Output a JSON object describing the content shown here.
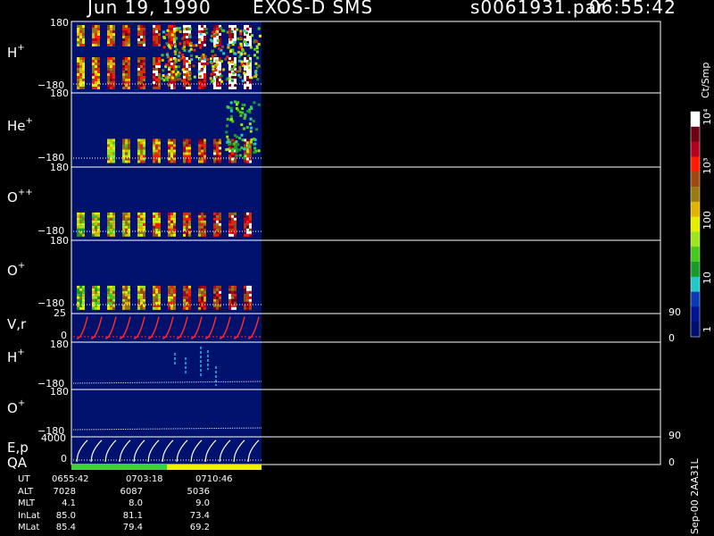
{
  "header": {
    "date": "Jun 19, 1990",
    "instrument": "EXOS-D SMS",
    "file": "s0061931.par",
    "time": "06:55:42"
  },
  "panels": [
    {
      "label": "H",
      "sup": "+",
      "tick_top": "180",
      "tick_bottom": "−180",
      "right_top": "",
      "right_bottom": ""
    },
    {
      "label": "He",
      "sup": "+",
      "tick_top": "180",
      "tick_bottom": "−180",
      "right_top": "",
      "right_bottom": ""
    },
    {
      "label": "O",
      "sup": "++",
      "tick_top": "180",
      "tick_bottom": "−180",
      "right_top": "",
      "right_bottom": ""
    },
    {
      "label": "O",
      "sup": "+",
      "tick_top": "180",
      "tick_bottom": "−180",
      "right_top": "",
      "right_bottom": ""
    },
    {
      "label": "V,r",
      "sup": "",
      "tick_top": "25",
      "tick_bottom": "0",
      "right_top": "90",
      "right_bottom": "0"
    },
    {
      "label": "H",
      "sup": "+",
      "tick_top": "180",
      "tick_bottom": "−180",
      "right_top": "",
      "right_bottom": ""
    },
    {
      "label": "O",
      "sup": "+",
      "tick_top": "180",
      "tick_bottom": "−180",
      "right_top": "",
      "right_bottom": ""
    },
    {
      "label": "E,p",
      "sup": "",
      "tick_top": "4000",
      "tick_bottom": "0",
      "right_top": "90",
      "right_bottom": "0"
    }
  ],
  "qa_label": "QA",
  "colorbar": {
    "unit": "Ct/Smp",
    "ticks": [
      "1",
      "10",
      "100",
      "10³",
      "10⁴"
    ],
    "colors": [
      "#000e6e",
      "#00128e",
      "#0a3ab4",
      "#26c7c9",
      "#1a9a2a",
      "#46c81e",
      "#9ee61e",
      "#e6ee00",
      "#e0b400",
      "#9a7a12",
      "#a04a12",
      "#ff1a00",
      "#b4001e",
      "#6e0014",
      "#ffffff"
    ]
  },
  "footer": {
    "rows": [
      {
        "label": "UT",
        "values": [
          "0655:42",
          "0703:18",
          "0710:46"
        ]
      },
      {
        "label": "ALT",
        "values": [
          "7028",
          "6087",
          "5036"
        ]
      },
      {
        "label": "MLT",
        "values": [
          "4.1",
          "8.0",
          "9.0"
        ]
      },
      {
        "label": "InLat",
        "values": [
          "85.0",
          "81.1",
          "73.4"
        ]
      },
      {
        "label": "MLat",
        "values": [
          "85.4",
          "79.4",
          "69.2"
        ]
      }
    ],
    "stamp": "Sep-00 2AA31L"
  },
  "chart_data": {
    "type": "heatmap",
    "title": "Jun 19, 1990 EXOS-D SMS",
    "x_ticks": [
      "0655:42",
      "0703:18",
      "0710:46"
    ],
    "panels": [
      {
        "name": "H+",
        "ylim": [
          -180,
          180
        ]
      },
      {
        "name": "He+",
        "ylim": [
          -180,
          180
        ]
      },
      {
        "name": "O++",
        "ylim": [
          -180,
          180
        ]
      },
      {
        "name": "O+",
        "ylim": [
          -180,
          180
        ]
      },
      {
        "name": "V,r",
        "ylim": [
          0,
          25
        ],
        "y2lim": [
          0,
          90
        ]
      },
      {
        "name": "H+",
        "ylim": [
          -180,
          180
        ]
      },
      {
        "name": "O+",
        "ylim": [
          -180,
          180
        ]
      },
      {
        "name": "E,p",
        "ylim": [
          0,
          4000
        ],
        "y2lim": [
          0,
          90
        ]
      }
    ],
    "colorbar": {
      "label": "Ct/Smp",
      "scale": "log",
      "range": [
        1,
        10000
      ]
    },
    "qa": [
      {
        "color": "#3cd23c",
        "from": "0655:42",
        "to": "0703:18"
      },
      {
        "color": "#f0f000",
        "from": "0703:18",
        "to": "0710:46"
      }
    ]
  }
}
